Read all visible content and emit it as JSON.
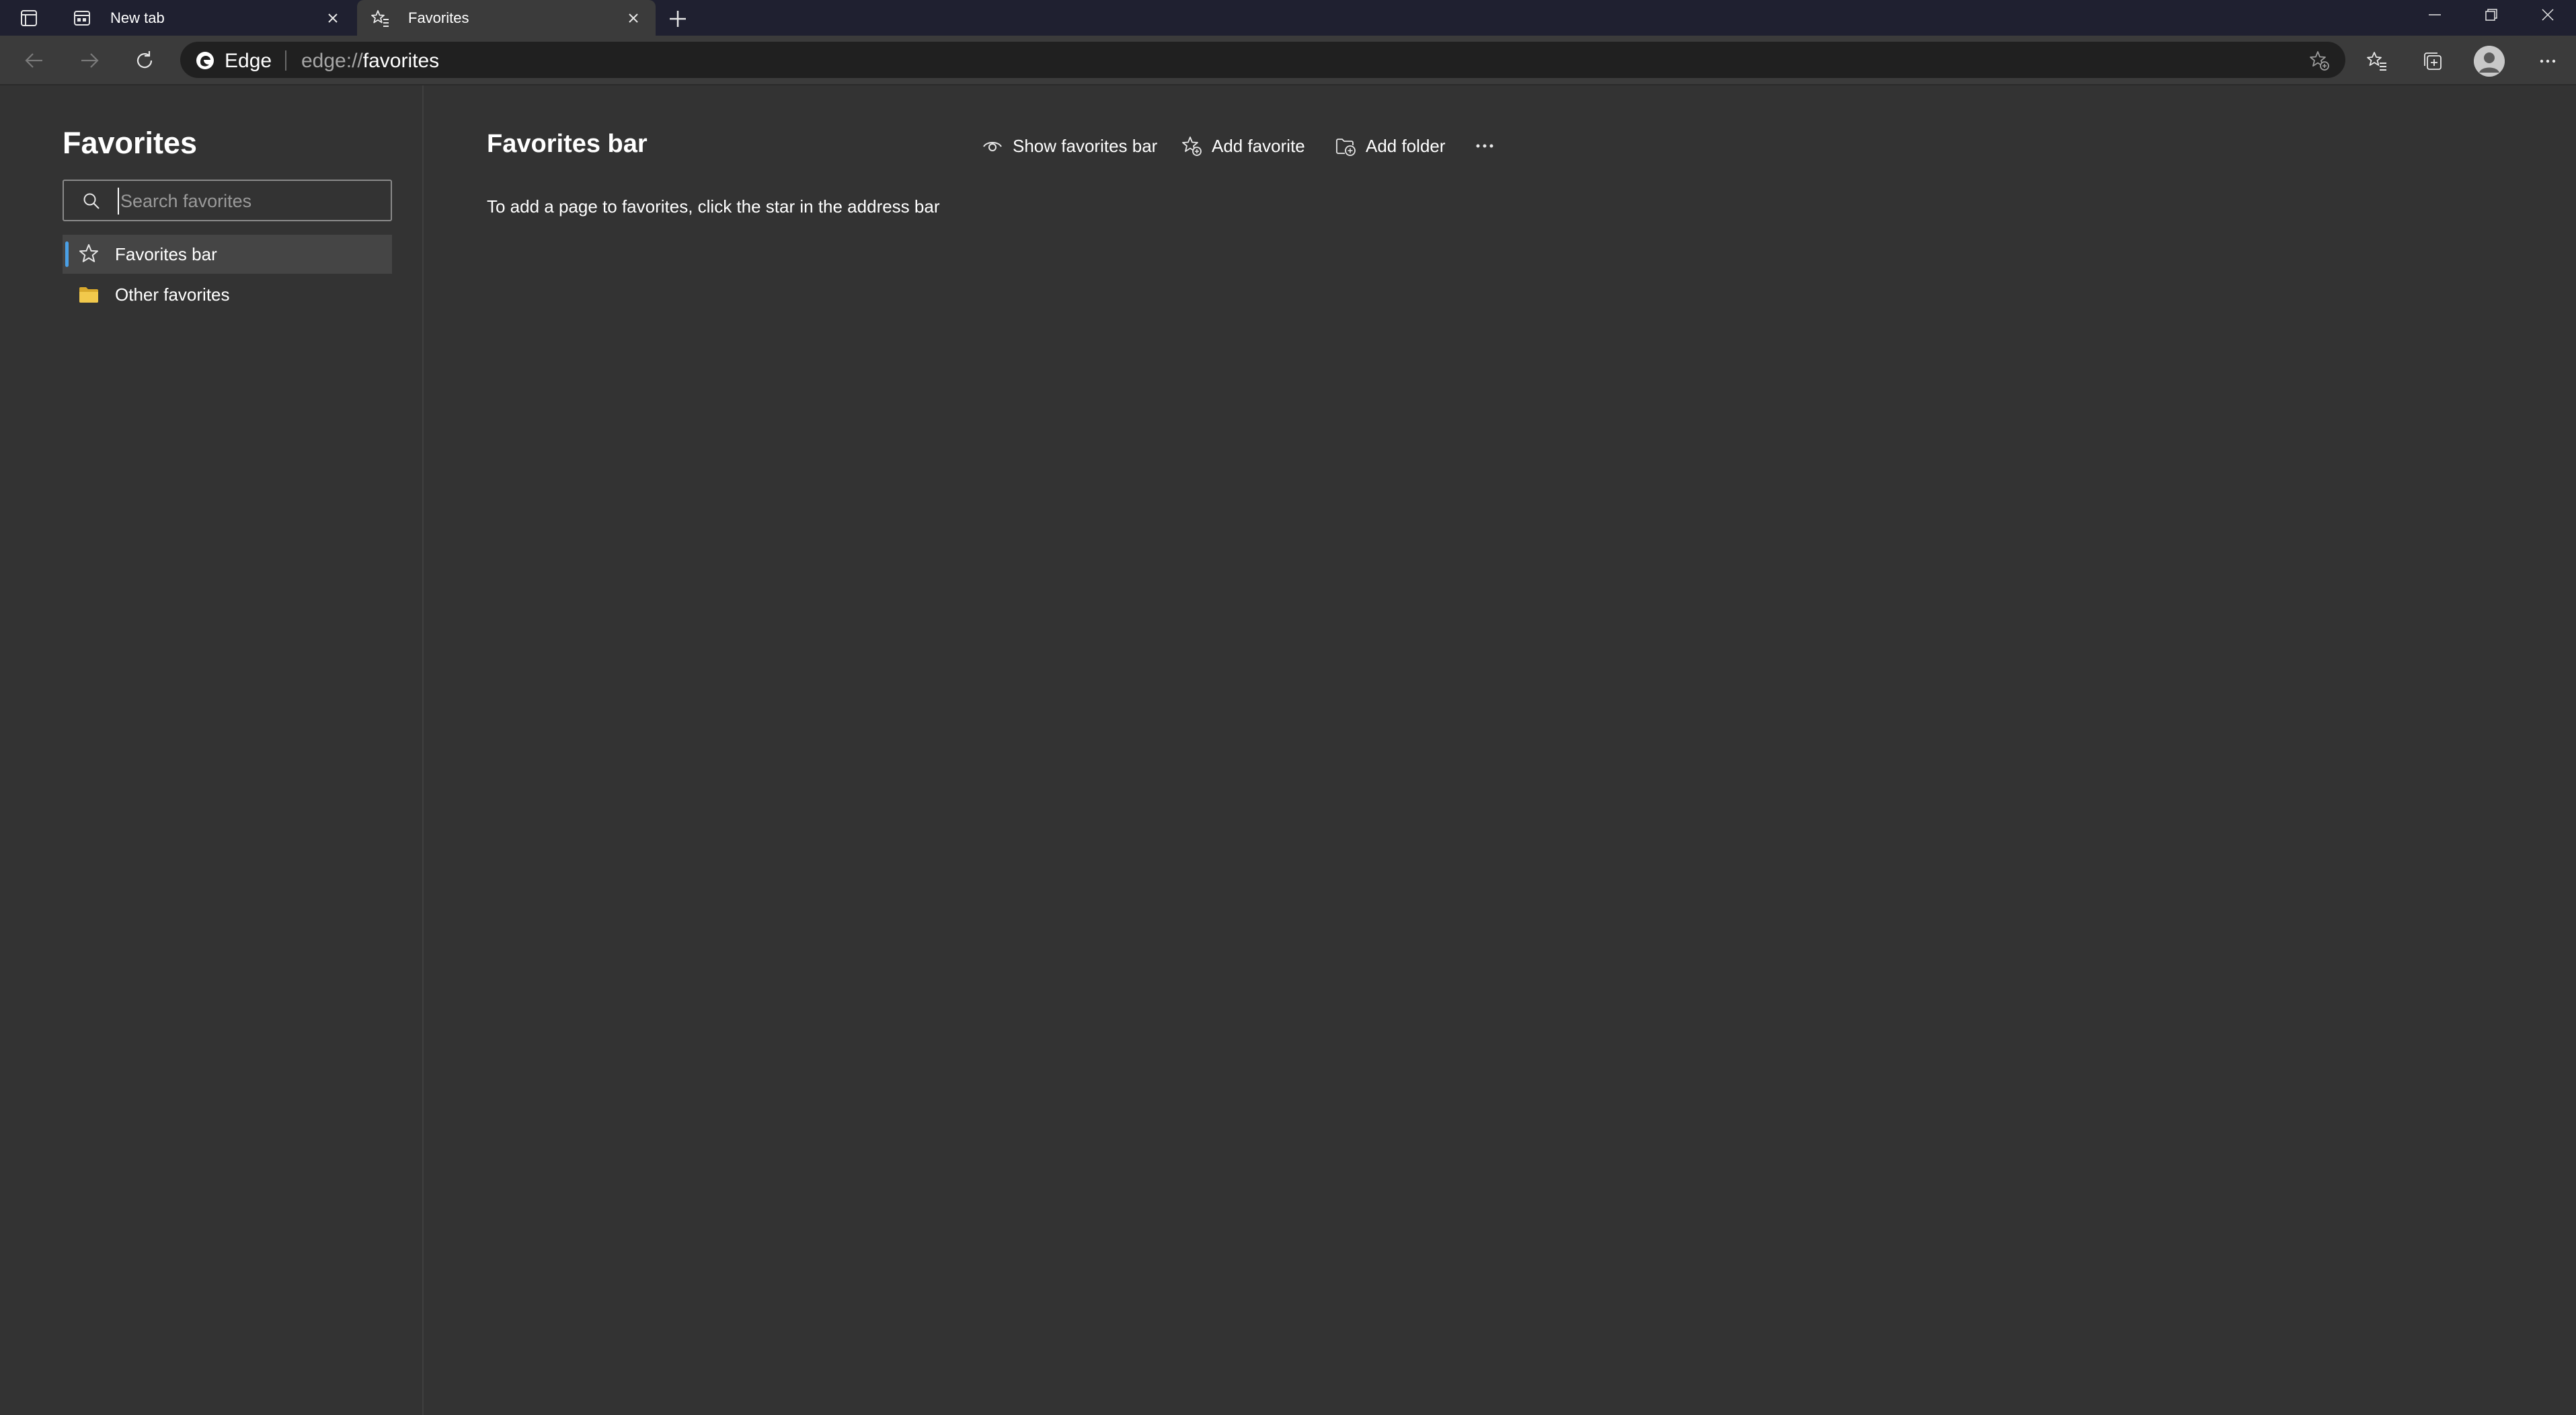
{
  "tabs": [
    {
      "title": "New tab",
      "icon": "new-tab-page-icon",
      "active": false
    },
    {
      "title": "Favorites",
      "icon": "favorites-star-icon",
      "active": true
    }
  ],
  "address_bar": {
    "site_label": "Edge",
    "url_scheme": "edge://",
    "url_host": "favorites"
  },
  "sidebar": {
    "title": "Favorites",
    "search_placeholder": "Search favorites",
    "items": [
      {
        "label": "Favorites bar",
        "icon": "star-icon",
        "selected": true
      },
      {
        "label": "Other favorites",
        "icon": "folder-icon",
        "selected": false
      }
    ]
  },
  "main": {
    "title": "Favorites bar",
    "commands": {
      "show_bar": "Show favorites bar",
      "add_favorite": "Add favorite",
      "add_folder": "Add folder"
    },
    "empty_message": "To add a page to favorites, click the star in the address bar"
  },
  "colors": {
    "titlebar": "#1f2030",
    "toolbar": "#3b3b3b",
    "page_background": "#333333",
    "selection_accent": "#4aa0e6",
    "folder": "#f2c94c"
  }
}
